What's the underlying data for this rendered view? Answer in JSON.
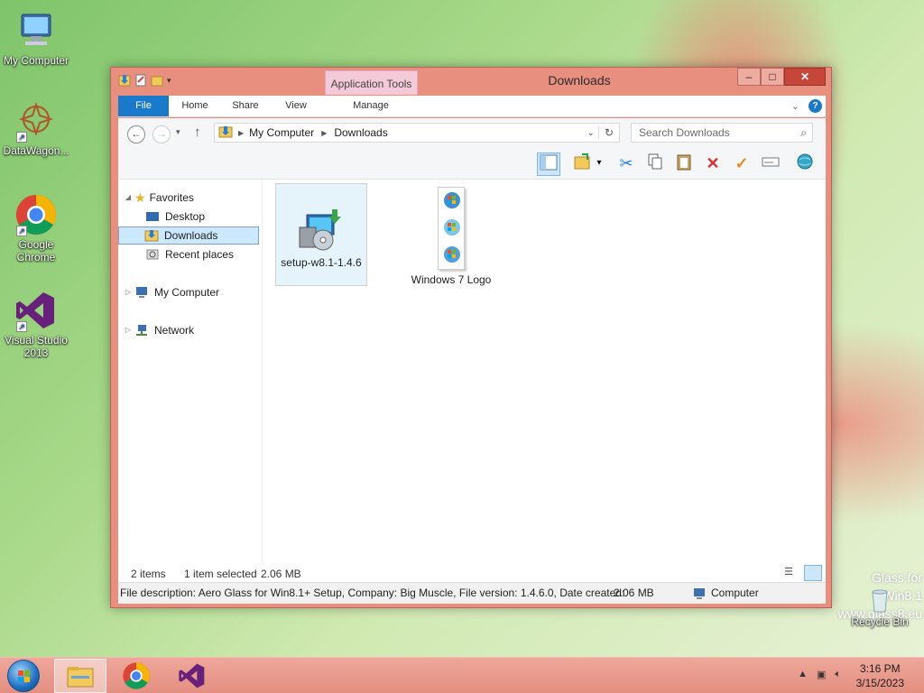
{
  "desktop": {
    "icons": [
      {
        "label": "My Computer",
        "icon": "computer-icon"
      },
      {
        "label": "DataWagon...",
        "icon": "datawagon-icon"
      },
      {
        "label": "Google Chrome",
        "icon": "chrome-icon"
      },
      {
        "label": "Visual Studio 2013",
        "icon": "visual-studio-icon"
      }
    ],
    "recycle_bin": "Recycle Bin",
    "watermark_line1": "Glass for Win8.1",
    "watermark_line2": "www.glass8.eu"
  },
  "window": {
    "title": "Downloads",
    "contextual_tab_group": "Application Tools",
    "controls": {
      "minimize": "–",
      "maximize": "□",
      "close": "✕"
    },
    "ribbon_tabs": [
      {
        "label": "File"
      },
      {
        "label": "Home"
      },
      {
        "label": "Share"
      },
      {
        "label": "View"
      },
      {
        "label": "Manage"
      }
    ],
    "address": {
      "breadcrumb": [
        "My Computer",
        "Downloads"
      ]
    },
    "search": {
      "placeholder": "Search Downloads"
    },
    "toolbar_icons": [
      "preview-pane-icon",
      "new-folder-icon",
      "cut-icon",
      "copy-icon",
      "paste-icon",
      "delete-icon",
      "select-icon",
      "rename-icon",
      "globe-icon"
    ],
    "nav_pane": {
      "favorites": "Favorites",
      "desktop": "Desktop",
      "downloads": "Downloads",
      "recent_places": "Recent places",
      "my_computer": "My Computer",
      "network": "Network"
    },
    "files": [
      {
        "name": "setup-w8.1-1.4.6",
        "selected": true
      },
      {
        "name": "Windows 7 Logo",
        "selected": false
      }
    ],
    "status": {
      "item_count": "2 items",
      "selection": "1 item selected",
      "selection_size": "2.06 MB"
    },
    "details": {
      "description": "File description: Aero Glass for Win8.1+ Setup, Company: Big Muscle, File version: 1.4.6.0, Date created:",
      "size": "2.06 MB",
      "location": "Computer"
    }
  },
  "taskbar": {
    "time": "3:16 PM",
    "date": "3/15/2023"
  },
  "colors": {
    "window_frame": "#e98f80",
    "file_tab": "#1979ca",
    "selection": "#cce8ff",
    "taskbar": "#e8998b"
  }
}
